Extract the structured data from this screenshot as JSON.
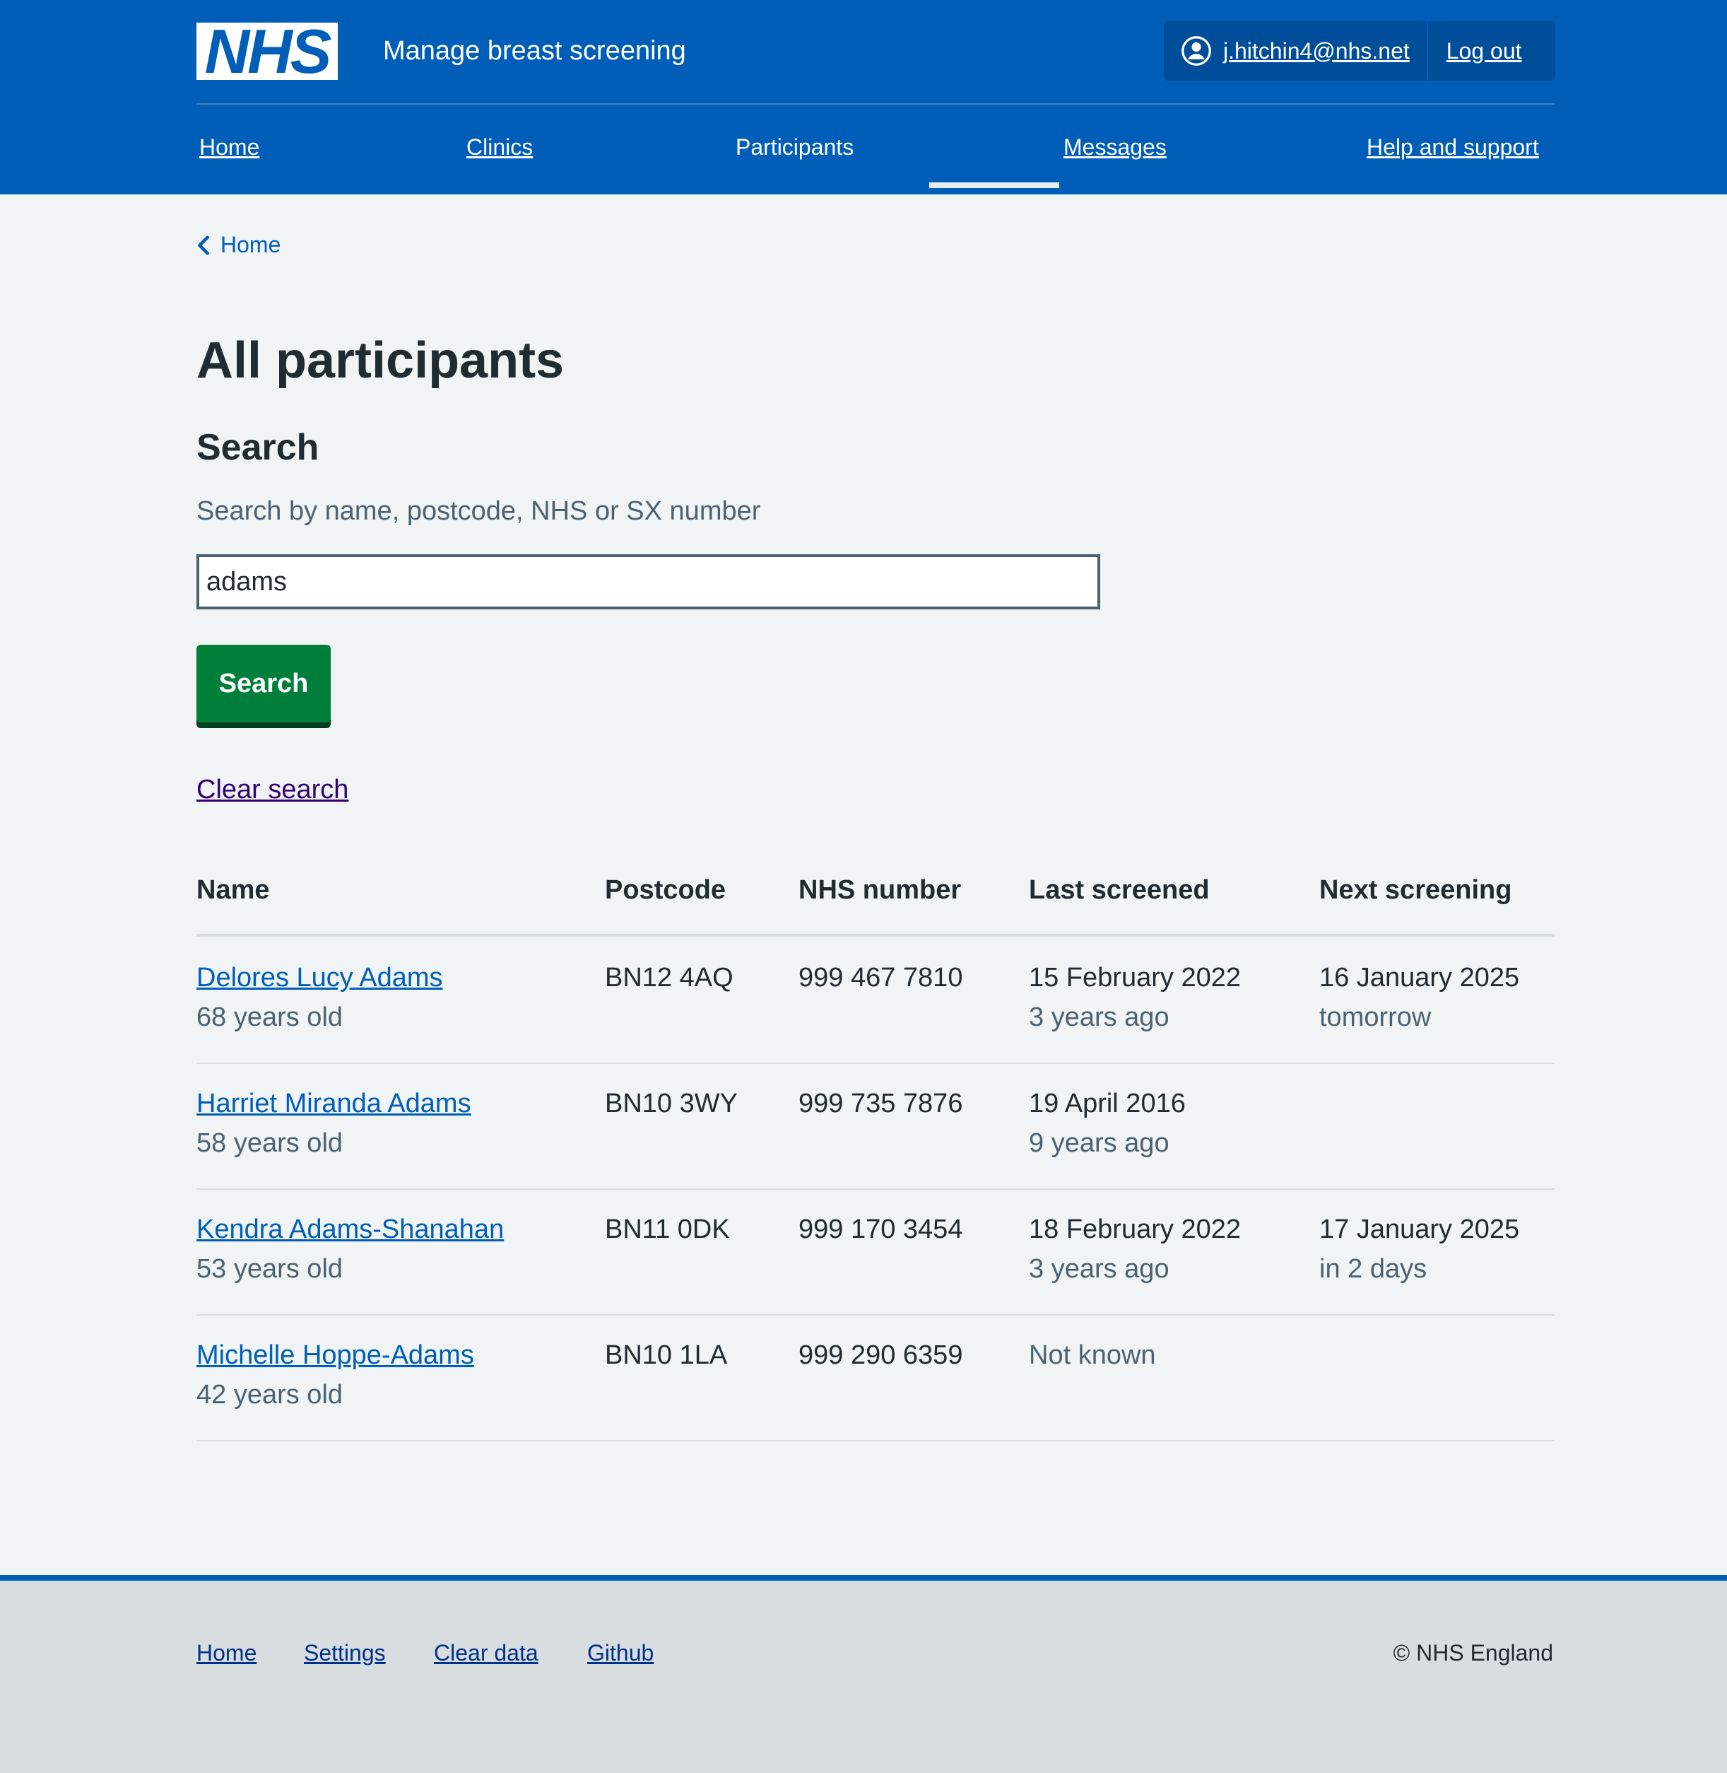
{
  "colors": {
    "nhs_blue": "#005eb8",
    "green": "#007f3b",
    "page_bg": "#f0f4f5",
    "text": "#212b32",
    "secondary": "#4c6272"
  },
  "header": {
    "logo": "NHS",
    "service_name": "Manage breast screening",
    "account": {
      "icon": "user-icon",
      "email": "j.hitchin4@nhs.net",
      "logout": "Log out"
    },
    "nav": [
      {
        "label": "Home"
      },
      {
        "label": "Clinics"
      },
      {
        "label": "Participants",
        "active": true
      },
      {
        "label": "Messages"
      },
      {
        "label": "Help and support"
      }
    ]
  },
  "back_link": {
    "icon": "chevron-left-icon",
    "label": "Home"
  },
  "page_title": "All participants",
  "search": {
    "heading": "Search",
    "hint": "Search by name, postcode, NHS or SX number",
    "value": "adams",
    "button": "Search",
    "clear": "Clear search"
  },
  "table": {
    "headers": [
      "Name",
      "Postcode",
      "NHS number",
      "Last screened",
      "Next screening"
    ],
    "rows": [
      {
        "name": "Delores Lucy Adams",
        "age": "68 years old",
        "postcode": "BN12 4AQ",
        "nhs": "999 467 7810",
        "last": "15 February 2022",
        "last_rel": "3 years ago",
        "next": "16 January 2025",
        "next_rel": "tomorrow"
      },
      {
        "name": "Harriet Miranda Adams",
        "age": "58 years old",
        "postcode": "BN10 3WY",
        "nhs": "999 735 7876",
        "last": "19 April 2016",
        "last_rel": "9 years ago",
        "next": "",
        "next_rel": ""
      },
      {
        "name": "Kendra Adams-Shanahan",
        "age": "53 years old",
        "postcode": "BN11 0DK",
        "nhs": "999 170 3454",
        "last": "18 February 2022",
        "last_rel": "3 years ago",
        "next": "17 January 2025",
        "next_rel": "in 2 days"
      },
      {
        "name": "Michelle Hoppe-Adams",
        "age": "42 years old",
        "postcode": "BN10 1LA",
        "nhs": "999 290 6359",
        "last": "Not known",
        "last_rel": "",
        "next": "",
        "next_rel": ""
      }
    ]
  },
  "footer": {
    "links": [
      "Home",
      "Settings",
      "Clear data",
      "Github"
    ],
    "copyright": "© NHS England"
  }
}
